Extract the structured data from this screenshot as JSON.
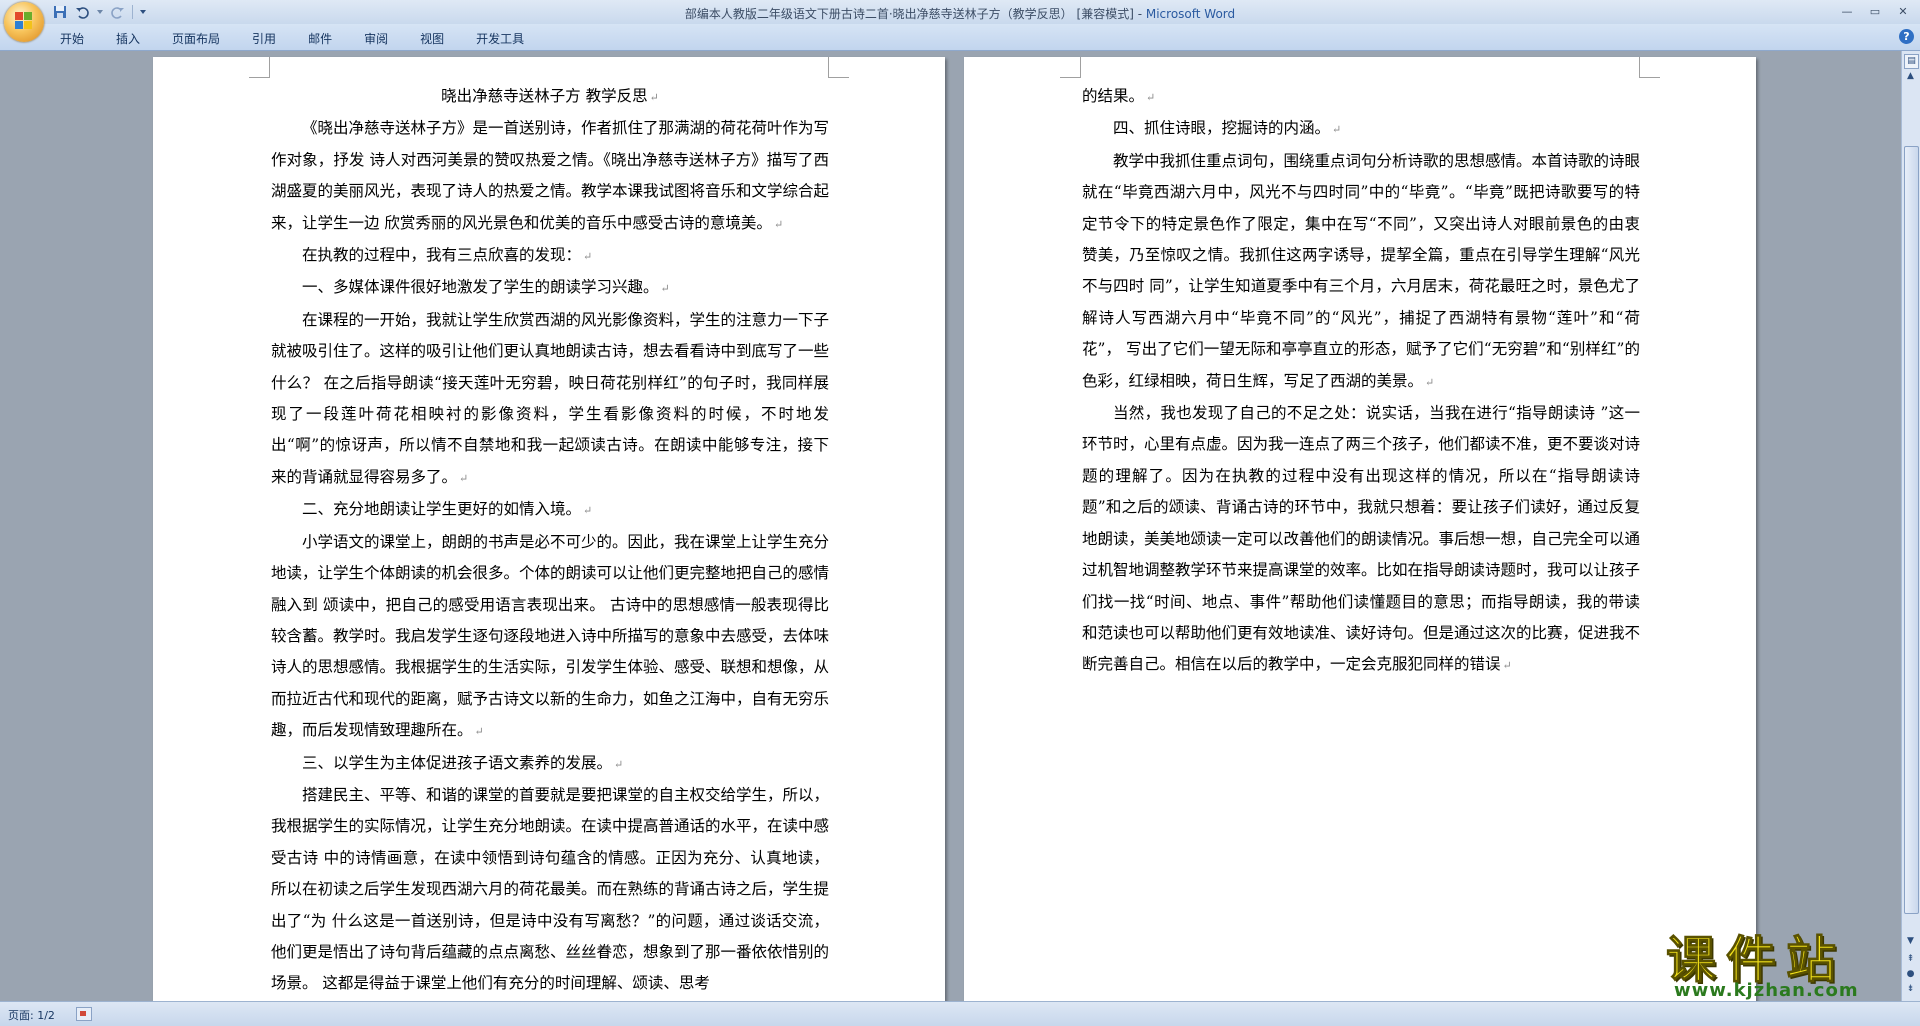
{
  "window": {
    "title_doc": "部编本人教版二年级语文下册古诗二首·晓出净慈寺送林子方（教学反思）",
    "title_mode": "[兼容模式]",
    "title_separator": " - ",
    "title_app": "Microsoft Word"
  },
  "quick_access": {
    "save_icon": "save-icon",
    "undo_icon": "undo-icon",
    "redo_icon": "redo-icon",
    "customize_icon": "chevron-down-icon"
  },
  "ribbon": {
    "tabs": [
      "开始",
      "插入",
      "页面布局",
      "引用",
      "邮件",
      "审阅",
      "视图",
      "开发工具"
    ],
    "help": "?"
  },
  "page1": {
    "title": "晓出净慈寺送林子方  教学反思",
    "paragraphs": [
      "《晓出净慈寺送林子方》是一首送别诗，作者抓住了那满湖的荷花荷叶作为写作对象，抒发 诗人对西河美景的赞叹热爱之情。《晓出净慈寺送林子方》描写了西湖盛夏的美丽风光，表现了诗人的热爱之情。教学本课我试图将音乐和文学综合起来，让学生一边 欣赏秀丽的风光景色和优美的音乐中感受古诗的意境美。",
      "在执教的过程中，我有三点欣喜的发现：",
      "一、多媒体课件很好地激发了学生的朗读学习兴趣。",
      "在课程的一开始，我就让学生欣赏西湖的风光影像资料，学生的注意力一下子就被吸引住了。这样的吸引让他们更认真地朗读古诗，想去看看诗中到底写了一些什么？ 在之后指导朗读“接天莲叶无穷碧，映日荷花别样红”的句子时，我同样展现了一段莲叶荷花相映衬的影像资料，学生看影像资料的时候，不时地发出“啊”的惊讶声，所以情不自禁地和我一起颂读古诗。在朗读中能够专注，接下来的背诵就显得容易多了。",
      "二、充分地朗读让学生更好的如情入境。",
      "小学语文的课堂上，朗朗的书声是必不可少的。因此，我在课堂上让学生充分地读，让学生个体朗读的机会很多。个体的朗读可以让他们更完整地把自己的感情融入到 颂读中，把自己的感受用语言表现出来。 古诗中的思想感情一般表现得比较含蓄。教学时。我启发学生逐句逐段地进入诗中所描写的意象中去感受，去体味诗人的思想感情。我根据学生的生活实际，引发学生体验、感受、联想和想像，从而拉近古代和现代的距离，赋予古诗文以新的生命力，如鱼之江海中，自有无穷乐趣，而后发现情致理趣所在。",
      "三、以学生为主体促进孩子语文素养的发展。",
      "搭建民主、平等、和谐的课堂的首要就是要把课堂的自主权交给学生，所以，我根据学生的实际情况，让学生充分地朗读。在读中提高普通话的水平，在读中感受古诗 中的诗情画意，在读中领悟到诗句蕴含的情感。正因为充分、认真地读，所以在初读之后学生发现西湖六月的荷花最美。而在熟练的背诵古诗之后，学生提出了“为 什么这是一首送别诗，但是诗中没有写离愁？”的问题，通过谈话交流，他们更是悟出了诗句背后蕴藏的点点离愁、丝丝眷恋，想象到了那一番依依惜别的场景。 这都是得益于课堂上他们有充分的时间理解、颂读、思考"
    ]
  },
  "page2": {
    "paragraphs": [
      "的结果。",
      "四、抓住诗眼，挖掘诗的内涵。",
      "教学中我抓住重点词句，围绕重点词句分析诗歌的思想感情。本首诗歌的诗眼就在“毕竟西湖六月中，风光不与四时同”中的“毕竟”。“毕竟”既把诗歌要写的特定节令下的特定景色作了限定，集中在写“不同”，又突出诗人对眼前景色的由衷赞美，乃至惊叹之情。我抓住这两字诱导，提挈全篇，重点在引导学生理解“风光不与四时 同”，让学生知道夏季中有三个月，六月居末，荷花最旺之时，景色尤了解诗人写西湖六月中“毕竟不同”的“风光”，捕捉了西湖特有景物“莲叶”和“荷花”， 写出了它们一望无际和亭亭直立的形态，赋予了它们“无穷碧”和“别样红”的色彩，红绿相映，荷日生辉，写足了西湖的美景。",
      "当然，我也发现了自己的不足之处：说实话，当我在进行“指导朗读诗 ”这一环节时，心里有点虚。因为我一连点了两三个孩子，他们都读不准，更不要谈对诗题的理解了。因为在执教的过程中没有出现这样的情况，所以在“指导朗读诗题”和之后的颂读、背诵古诗的环节中，我就只想着：要让孩子们读好，通过反复地朗读，美美地颂读一定可以改善他们的朗读情况。事后想一想，自己完全可以通过机智地调整教学环节来提高课堂的效率。比如在指导朗读诗题时，我可以让孩子们找一找“时间、地点、事件”帮助他们读懂题目的意思；而指导朗读，我的带读和范读也可以帮助他们更有效地读准、读好诗句。但是通过这次的比赛，促进我不断完善自己。相信在以后的教学中，一定会克服犯同样的错误"
    ]
  },
  "status": {
    "page_label": "页面: 1/2"
  },
  "watermark": {
    "title": "课件站",
    "url": "www.kjzhan.com"
  }
}
